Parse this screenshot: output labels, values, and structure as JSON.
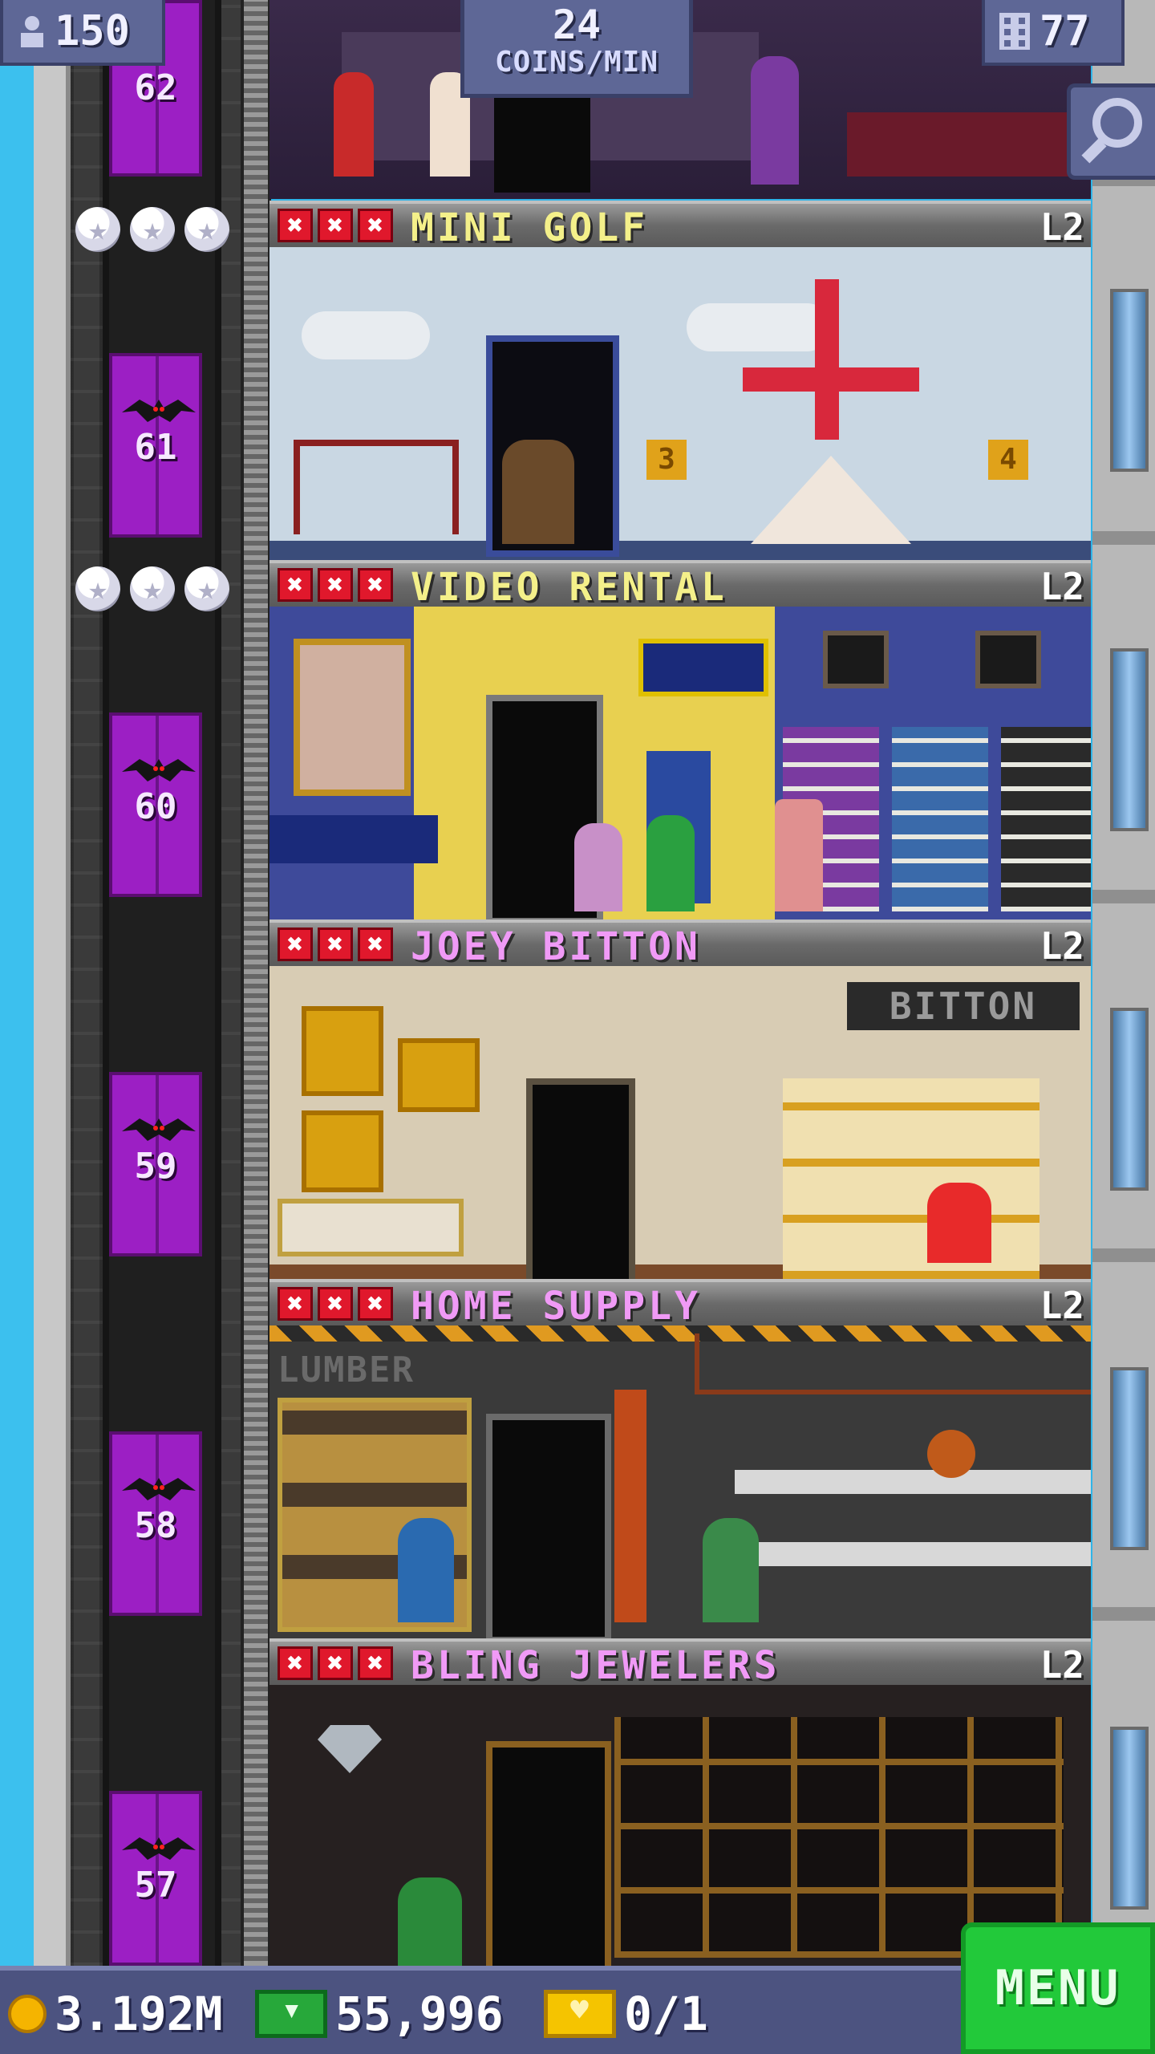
{
  "hud": {
    "population": "150",
    "coins_per_min_value": "24",
    "coins_per_min_label": "COINS/MIN",
    "floors": "77"
  },
  "top_floor": {
    "number": "62"
  },
  "floors": [
    {
      "number": "61",
      "name": "MINI GOLF",
      "level": "L2",
      "name_color": "#f4f08a",
      "stars": 3
    },
    {
      "number": "60",
      "name": "VIDEO RENTAL",
      "level": "L2",
      "name_color": "#f4f08a",
      "stars": 3
    },
    {
      "number": "59",
      "name": "JOEY BITTON",
      "level": "L2",
      "name_color": "#f09af6",
      "stars": 0
    },
    {
      "number": "58",
      "name": "HOME SUPPLY",
      "level": "L2",
      "name_color": "#f09af6",
      "stars": 0
    },
    {
      "number": "57",
      "name": "BLING JEWELERS",
      "level": "L2",
      "name_color": "#f09af6",
      "stars": 0
    }
  ],
  "x_mark": "✖",
  "sign_bitton": "BITTON",
  "sign_lumber": "LUMBER",
  "hole_3": "3",
  "hole_4": "4",
  "bottom": {
    "coins": "3.192M",
    "bux": "55,996",
    "tickets": "0/1",
    "menu_label": "MENU"
  },
  "icons": {
    "population": "person-icon",
    "floors": "building-icon",
    "search": "magnifier-icon",
    "coin": "coin-icon",
    "bux": "bux-icon",
    "ticket": "vip-ticket-icon",
    "star": "star-icon",
    "bat": "bat-icon"
  },
  "colors": {
    "elevator": "#9c1fc4",
    "hud": "#5e6796",
    "menu": "#22c93a",
    "x_mark": "#e0182c"
  }
}
